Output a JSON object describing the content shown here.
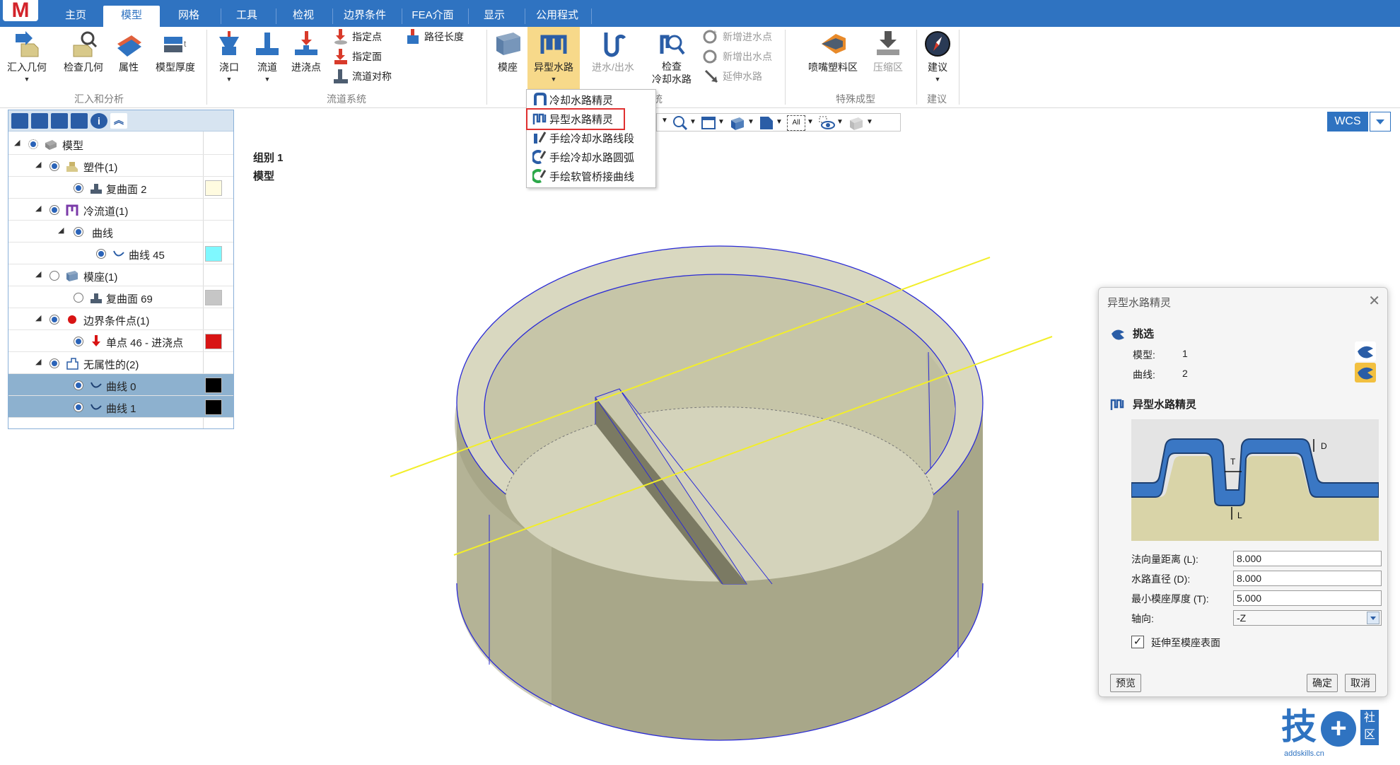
{
  "app": {
    "logo": "M"
  },
  "tabs": [
    {
      "label": "主页"
    },
    {
      "label": "模型"
    },
    {
      "label": "网格"
    },
    {
      "label": "工具"
    },
    {
      "label": "检视"
    },
    {
      "label": "边界条件"
    },
    {
      "label": "FEA介面"
    },
    {
      "label": "显示"
    },
    {
      "label": "公用程式"
    }
  ],
  "ribbon": {
    "import_geometry": "汇入几何",
    "check_geometry": "检查几何",
    "properties": "属性",
    "model_thickness": "模型厚度",
    "group_import": "汇入和分析",
    "gate": "浇口",
    "runner": "流道",
    "injection_point": "进浇点",
    "assign_point": "指定点",
    "assign_face": "指定面",
    "runner_symmetry": "流道对称",
    "path_length": "路径长度",
    "group_runner": "流道系统",
    "mold_base": "模座",
    "conformal_cooling": "异型水路",
    "inlet_outlet": "进水/出水",
    "check_cooling_1": "检查",
    "check_cooling_2": "冷却水路",
    "add_inlet": "新增进水点",
    "add_outlet": "新增出水点",
    "extend_channel": "延伸水路",
    "group_cooling_suffix": "统",
    "nozzle_area": "喷嘴塑料区",
    "compression_zone": "压缩区",
    "group_special": "特殊成型",
    "suggest": "建议",
    "group_suggest": "建议"
  },
  "menu": {
    "items": [
      {
        "label": "冷却水路精灵"
      },
      {
        "label": "异型水路精灵"
      },
      {
        "label": "手绘冷却水路线段"
      },
      {
        "label": "手绘冷却水路圆弧"
      },
      {
        "label": "手绘软管桥接曲线"
      }
    ]
  },
  "tree": {
    "rows": [
      {
        "label": "模型"
      },
      {
        "label": "塑件(1)"
      },
      {
        "label": "复曲面 2"
      },
      {
        "label": "冷流道(1)"
      },
      {
        "label": "曲线"
      },
      {
        "label": "曲线 45"
      },
      {
        "label": "模座(1)"
      },
      {
        "label": "复曲面 69"
      },
      {
        "label": "边界条件点(1)"
      },
      {
        "label": "单点 46 - 进浇点"
      },
      {
        "label": "无属性的(2)"
      },
      {
        "label": "曲线 0"
      },
      {
        "label": "曲线 1"
      }
    ],
    "colors": {
      "part": "#fffbe0",
      "curve45": "#7ff8ff",
      "mold": "#c6c6c6",
      "gate": "#d81414",
      "curve0": "#000000",
      "curve1": "#000000"
    }
  },
  "viewport": {
    "group": "组别 1",
    "model": "模型",
    "all_label": "All"
  },
  "wcs": {
    "label": "WCS"
  },
  "dialog": {
    "title": "异型水路精灵",
    "pick_section": "挑选",
    "model_label": "模型:",
    "model_count": "1",
    "curve_label": "曲线:",
    "curve_count": "2",
    "wizard_section": "异型水路精灵",
    "diagram_T": "T",
    "diagram_D": "D",
    "diagram_L": "L",
    "normal_distance_label": "法向量距离 (L):",
    "normal_distance": "8.000",
    "channel_diameter_label": "水路直径 (D):",
    "channel_diameter": "8.000",
    "min_mold_thickness_label": "最小模座厚度 (T):",
    "min_mold_thickness": "5.000",
    "axis_label": "轴向:",
    "axis_value": "-Z",
    "extend_checkbox": "延伸至模座表面",
    "extend_checked": true,
    "preview": "预览",
    "ok": "确定",
    "cancel": "取消"
  },
  "watermark": {
    "brand": "技",
    "sub1": "社",
    "sub2": "区",
    "url": "addskills.cn"
  }
}
